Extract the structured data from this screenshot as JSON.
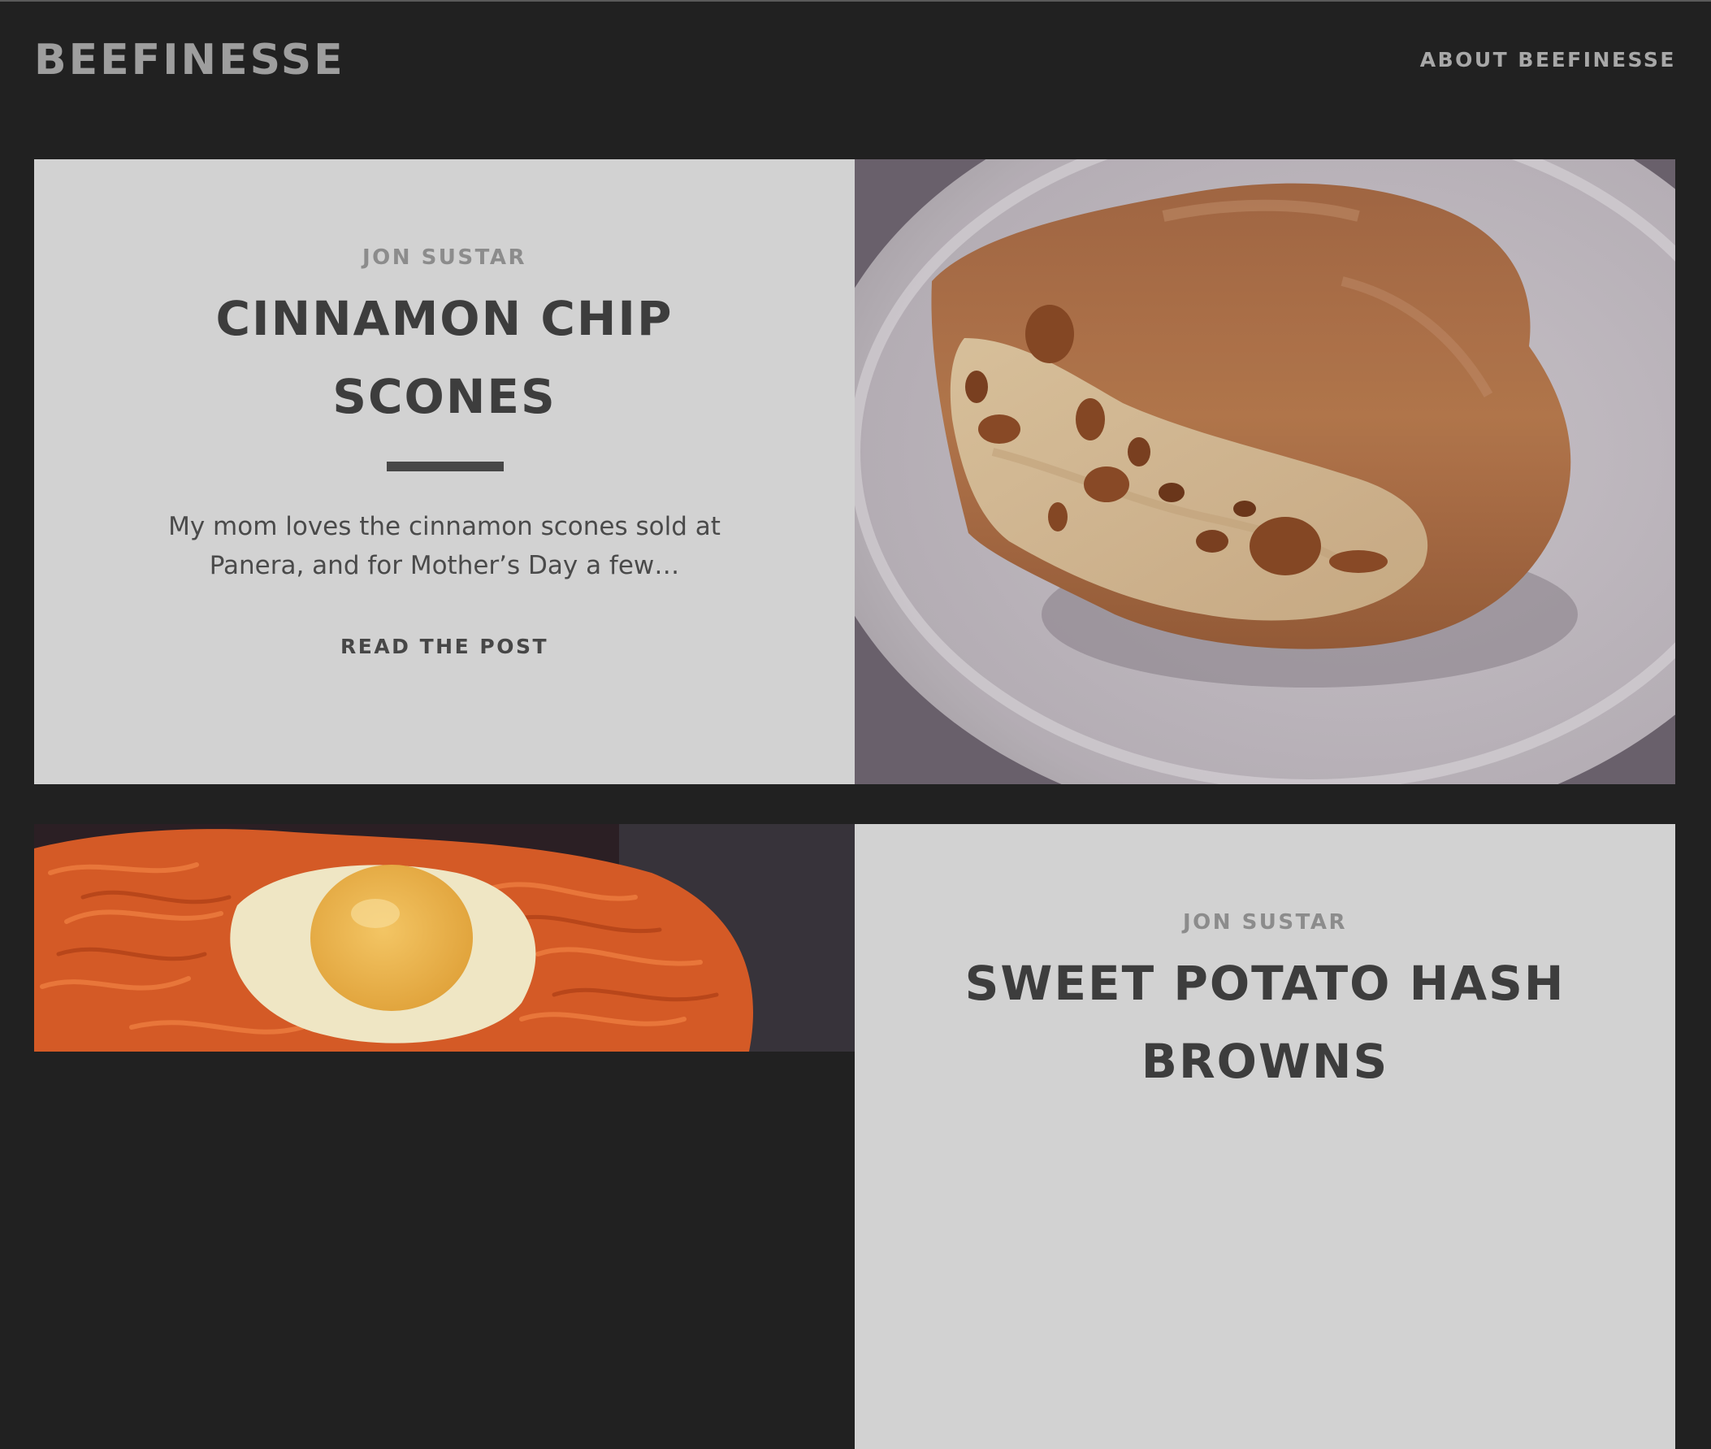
{
  "site": {
    "brand": "BEEFINESSE",
    "nav_about": "ABOUT BEEFINESSE"
  },
  "posts": [
    {
      "author": "JON SUSTAR",
      "title": "CINNAMON CHIP SCONES",
      "excerpt": "My mom loves the cinnamon scones sold at Panera, and for Mother’s Day a few…",
      "read_label": "READ THE POST",
      "image_icon": "scone-photo"
    },
    {
      "author": "JON SUSTAR",
      "title": "SWEET POTATO HASH BROWNS",
      "image_icon": "hash-browns-photo"
    }
  ]
}
